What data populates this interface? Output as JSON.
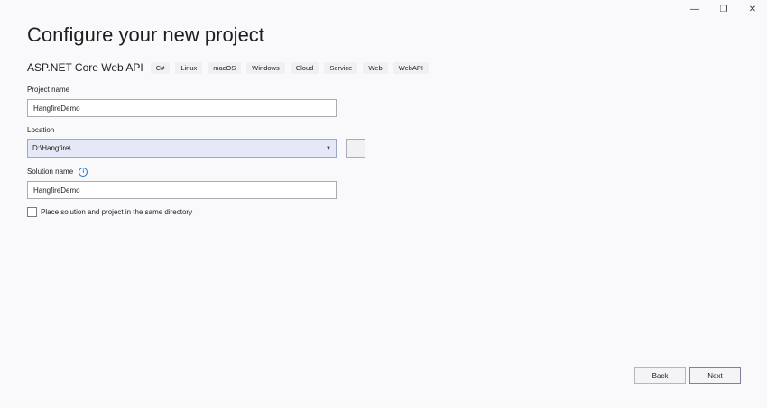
{
  "window": {
    "minimize_label": "—",
    "restore_label": "❐",
    "close_label": "✕"
  },
  "title": "Configure your new project",
  "template": {
    "name": "ASP.NET Core Web API",
    "tags": [
      "C#",
      "Linux",
      "macOS",
      "Windows",
      "Cloud",
      "Service",
      "Web",
      "WebAPI"
    ]
  },
  "project_name": {
    "label": "Project name",
    "value": "HangfireDemo"
  },
  "location": {
    "label": "Location",
    "value": "D:\\Hangfire\\",
    "browse_label": "..."
  },
  "solution_name": {
    "label": "Solution name",
    "value": "HangfireDemo"
  },
  "same_directory": {
    "label": "Place solution and project in the same directory",
    "checked": false
  },
  "footer": {
    "back_label": "Back",
    "next_label": "Next"
  }
}
